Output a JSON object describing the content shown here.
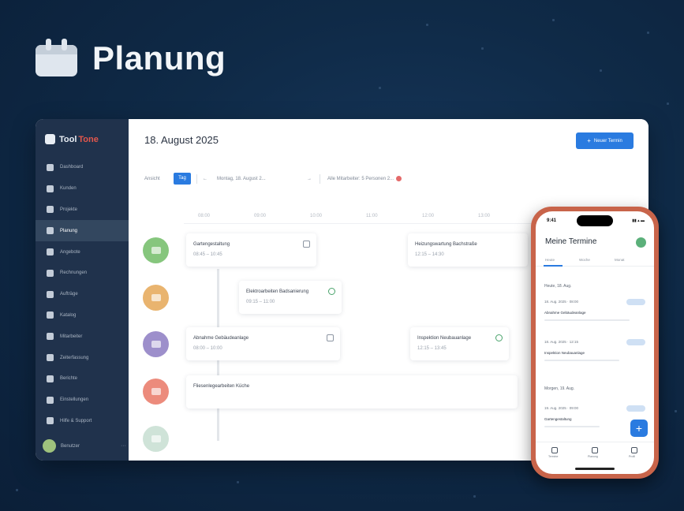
{
  "hero": {
    "title": "Planung",
    "icon": "calendar-icon"
  },
  "app": {
    "brand": {
      "part1": "Tool",
      "part2": "Tone"
    },
    "sidebar": {
      "items": [
        {
          "label": "Dashboard"
        },
        {
          "label": "Kunden"
        },
        {
          "label": "Projekte"
        },
        {
          "label": "Planung",
          "active": true
        },
        {
          "label": "Angebote"
        },
        {
          "label": "Rechnungen"
        },
        {
          "label": "Aufträge"
        },
        {
          "label": "Katalog"
        },
        {
          "label": "Mitarbeiter"
        },
        {
          "label": "Zeiterfassung"
        },
        {
          "label": "Berichte"
        },
        {
          "label": "Einstellungen"
        },
        {
          "label": "Hilfe & Support"
        }
      ],
      "user": {
        "name": "Benutzer",
        "more": "···"
      }
    },
    "header": {
      "date": "18. August 2025",
      "new_button": "Neuer Termin"
    },
    "toolbar": {
      "view_label": "Ansicht",
      "view_active": "Tag",
      "nav_prev": "←",
      "range": "Montag, 18. August 2...",
      "nav_next": "→",
      "filter": "Alle Mitarbeiter: 5 Personen 2..."
    },
    "hours": [
      "08:00",
      "09:00",
      "10:00",
      "11:00",
      "12:00",
      "13:00"
    ],
    "employees": [
      {
        "color": "#86c67d"
      },
      {
        "color": "#e9b46f"
      },
      {
        "color": "#9d8fcb"
      },
      {
        "color": "#ec8b7c"
      },
      {
        "color": "#cfe3d8"
      }
    ],
    "events": [
      {
        "title": "Gartengestaltung",
        "time": "08:45 – 10:45"
      },
      {
        "title": "Heizungswartung Bachstraße",
        "time": "12:15 – 14:30"
      },
      {
        "title": "Elektroarbeiten Badsanierung",
        "time": "09:15 – 11:00"
      },
      {
        "title": "Abnahme Gebäudeanlage",
        "time": "08:00 – 10:00"
      },
      {
        "title": "Inspektion Neubauanlage",
        "time": "12:15 – 13:45"
      },
      {
        "title": "Fliesenlegearbeiten Küche",
        "time": "08:00 – 12:00"
      }
    ]
  },
  "phone": {
    "time": "9:41",
    "status": "▮▮ ▴ ▬",
    "title": "Meine Termine",
    "tabs": [
      "Heute",
      "Woche",
      "Monat"
    ],
    "sections": [
      {
        "label": "Heute, 18. Aug.",
        "items": [
          {
            "date": "18. Aug. 2025 · 08:00",
            "title": "Abnahme Gebäudeanlage"
          },
          {
            "date": "18. Aug. 2025 · 12:15",
            "title": "Inspektion Neubauanlage"
          }
        ]
      },
      {
        "label": "Morgen, 19. Aug.",
        "items": [
          {
            "date": "19. Aug. 2025 · 09:00",
            "title": "Gartengestaltung"
          }
        ]
      }
    ],
    "fab": "+",
    "nav": [
      "Termine",
      "Planung",
      "Profil"
    ]
  }
}
